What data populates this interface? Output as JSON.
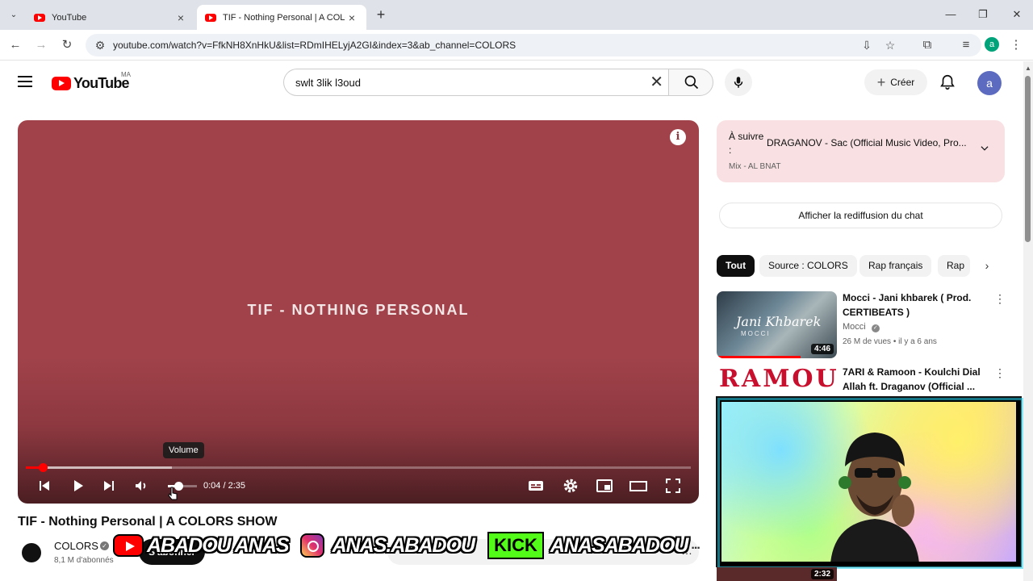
{
  "browser": {
    "tabs": [
      {
        "title": "YouTube",
        "active": false
      },
      {
        "title": "TIF - Nothing Personal | A COLO",
        "active": true
      }
    ],
    "new_tab": "+",
    "url": "youtube.com/watch?v=FfkNH8XnHkU&list=RDmIHELyjA2GI&index=3&ab_channel=COLORS",
    "profile_initial": "a",
    "window_controls": {
      "minimize": "—",
      "maximize": "❐",
      "close": "✕"
    }
  },
  "header": {
    "logo_text": "YouTube",
    "country_code": "MA",
    "search_query": "swlt 3lik l3oud",
    "create_label": "Créer",
    "avatar_initial": "a"
  },
  "player": {
    "video_title_overlay": "TIF - NOTHING PERSONAL",
    "info_icon": "i",
    "time_current": "0:04",
    "time_total": "2:35",
    "time_display": "0:04 / 2:35",
    "progress_fraction": 0.026,
    "buffer_fraction": 0.22,
    "volume_fraction": 0.35,
    "tooltip": "Volume"
  },
  "video": {
    "title": "TIF - Nothing Personal | A COLORS SHOW",
    "channel": "COLORS",
    "subscribers": "8,1 M d'abonnés",
    "subscribe_label": "S'abonner"
  },
  "overlay_banner": {
    "youtube_handle": "ABADOU ANAS",
    "instagram_handle": "ANAS.ABADOU",
    "kick_label": "KICK",
    "kick_handle": "ANASABADOU",
    "trailing": "..."
  },
  "sidebar": {
    "up_next_label": "À suivre :",
    "up_next_title": "DRAGANOV - Sac (Official Music Video, Pro...",
    "mix_label": "Mix - AL BNAT",
    "chat_replay_label": "Afficher la rediffusion du chat",
    "chips": [
      "Tout",
      "Source : COLORS",
      "Rap français",
      "Rap"
    ],
    "recommendations": [
      {
        "title": "Mocci - Jani khbarek ( Prod. CERTIBEATS )",
        "channel": "Mocci",
        "meta": "26 M de vues • il y a 6 ans",
        "duration": "4:46",
        "thumb_text": "Jani Khbarek",
        "thumb_subtext": "MOCCI",
        "watched_fraction": 0.7
      },
      {
        "title": "7ARI & Ramoon - Koulchi Dial Allah ft. Draganov (Official ...",
        "thumb_text": "RAMOUNI"
      },
      {
        "duration": "2:32"
      }
    ]
  },
  "colors": {
    "player_bg": "#a1424a",
    "yt_red": "#ff0000",
    "kick_green": "#53fc18",
    "up_next_bg": "#f9e1e3"
  }
}
